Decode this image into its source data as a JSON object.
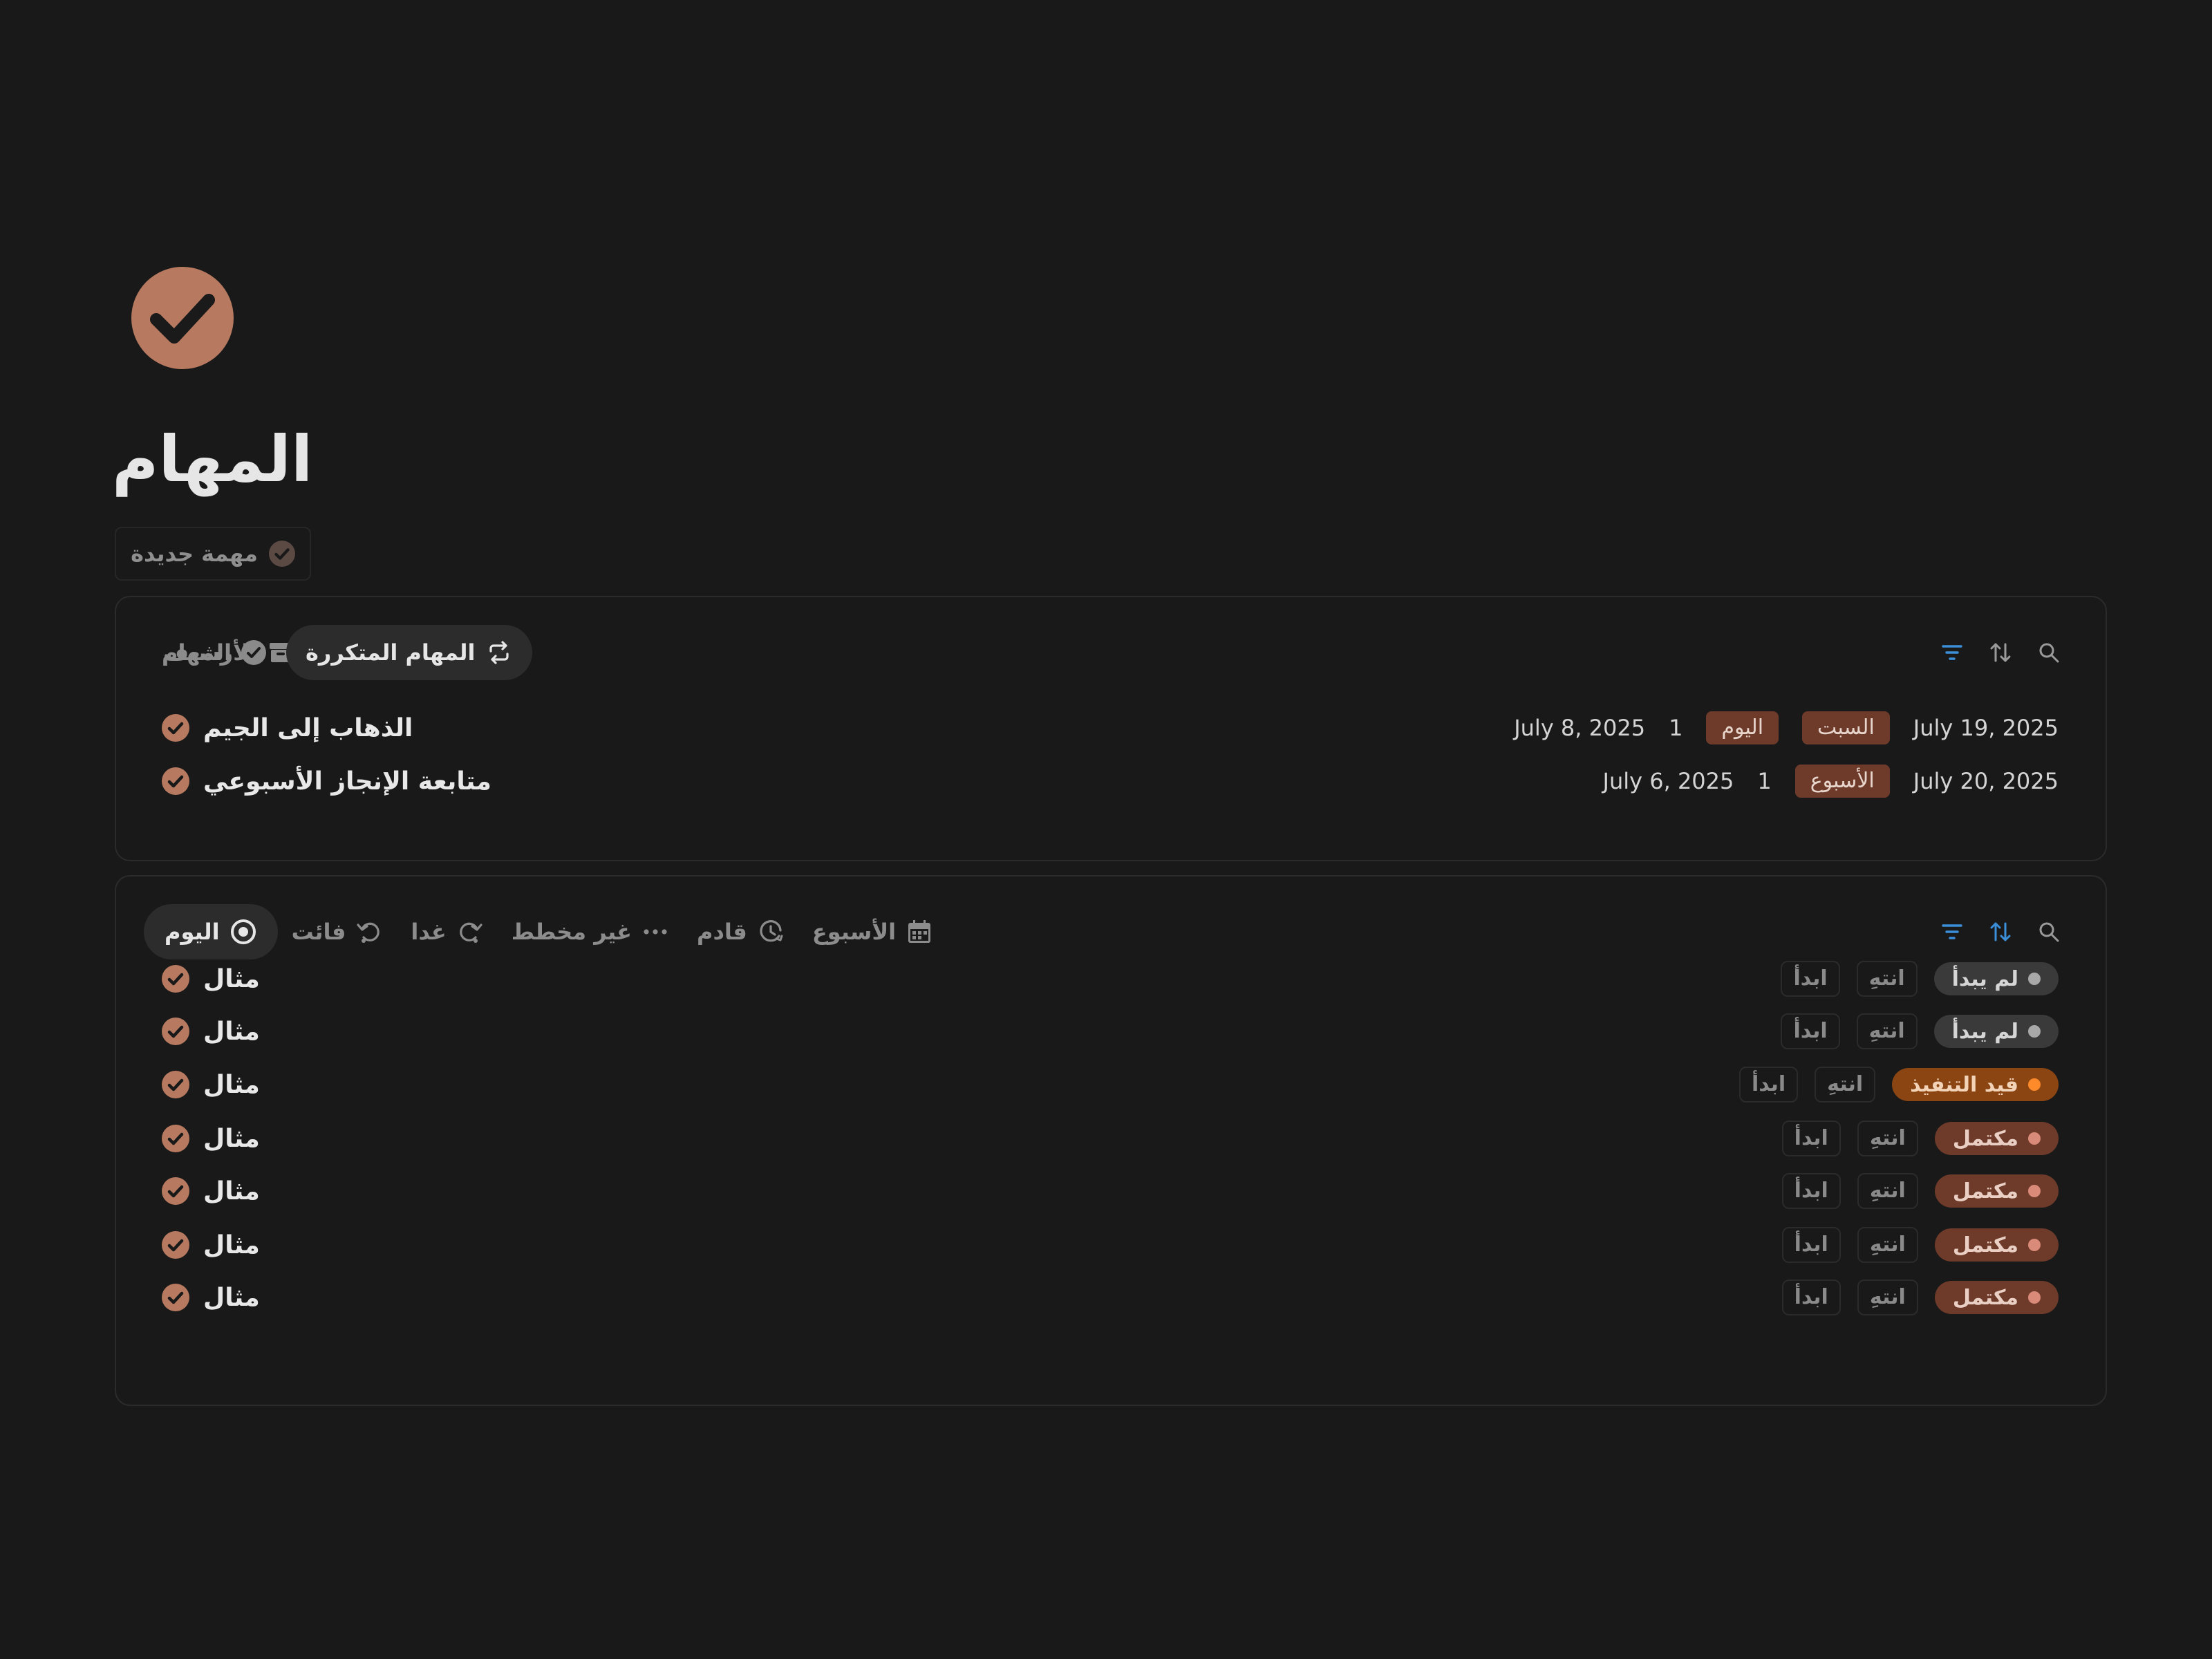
{
  "page": {
    "title": "المهام",
    "icon": "check-circle-icon",
    "accent_color": "#b77a60"
  },
  "new_task_button": {
    "label": "مهمة جديدة"
  },
  "recurring_panel": {
    "tabs": [
      {
        "label": "المهام",
        "icon": "check-circle-icon",
        "active": false
      },
      {
        "label": "المهام المتكررة",
        "icon": "repeat-icon",
        "active": true
      },
      {
        "label": "الأرشيف",
        "icon": "archive-icon",
        "active": false
      }
    ],
    "rows": [
      {
        "title": "الذهاب إلى الجيم",
        "next_date": "July 19, 2025",
        "day_tag": "السبت",
        "period_tag": "اليوم",
        "count": "1",
        "last_date": "July 8, 2025"
      },
      {
        "title": "متابعة الإنجاز الأسبوعي",
        "next_date": "July 20, 2025",
        "period_tag": "الأسبوع",
        "count": "1",
        "last_date": "July 6, 2025"
      }
    ]
  },
  "daily_panel": {
    "tabs": [
      {
        "label": "اليوم",
        "icon": "target-icon",
        "active": true
      },
      {
        "label": "فائت",
        "icon": "undo-icon",
        "active": false
      },
      {
        "label": "غدا",
        "icon": "redo-icon",
        "active": false
      },
      {
        "label": "غير مخطط",
        "icon": "more-icon",
        "active": false
      },
      {
        "label": "قادم",
        "icon": "clock-arrow-icon",
        "active": false
      },
      {
        "label": "الأسبوع",
        "icon": "calendar-icon",
        "active": false
      }
    ],
    "start_label": "ابدأ",
    "finish_label": "انتهِ",
    "rows": [
      {
        "title": "مثال",
        "status": "لم يبدأ",
        "status_key": "not-started"
      },
      {
        "title": "مثال",
        "status": "لم يبدأ",
        "status_key": "not-started"
      },
      {
        "title": "مثال",
        "status": "قيد التنفيذ",
        "status_key": "in-progress"
      },
      {
        "title": "مثال",
        "status": "مكتمل",
        "status_key": "done"
      },
      {
        "title": "مثال",
        "status": "مكتمل",
        "status_key": "done"
      },
      {
        "title": "مثال",
        "status": "مكتمل",
        "status_key": "done"
      },
      {
        "title": "مثال",
        "status": "مكتمل",
        "status_key": "done"
      }
    ]
  }
}
